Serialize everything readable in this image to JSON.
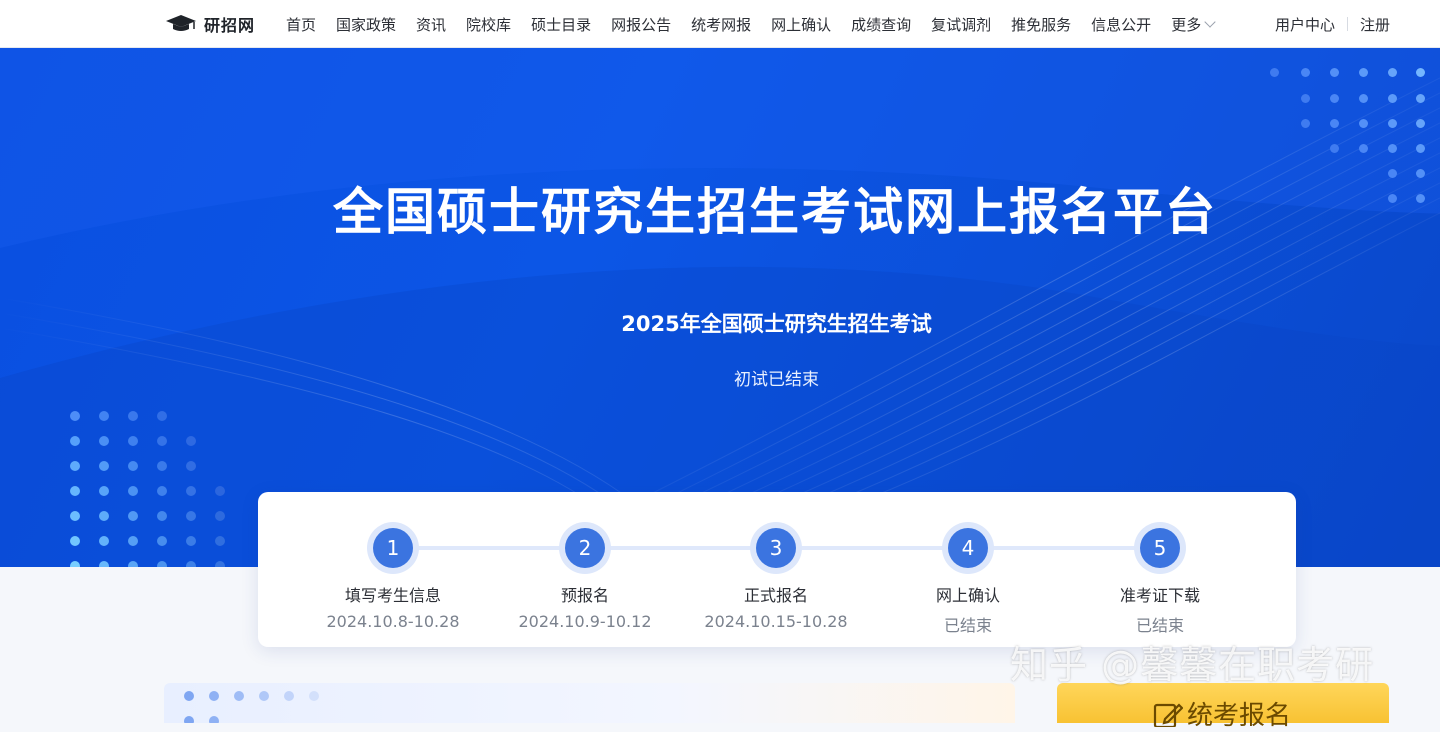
{
  "header": {
    "brand": "研招网",
    "nav": [
      "首页",
      "国家政策",
      "资讯",
      "院校库",
      "硕士目录",
      "网报公告",
      "统考网报",
      "网上确认",
      "成绩查询",
      "复试调剂",
      "推免服务",
      "信息公开"
    ],
    "more_label": "更多",
    "user_center": "用户中心",
    "register": "注册"
  },
  "hero": {
    "title": "全国硕士研究生招生考试网上报名平台",
    "subtitle": "2025年全国硕士研究生招生考试",
    "status": "初试已结束"
  },
  "steps": [
    {
      "num": "1",
      "name": "填写考生信息",
      "date": "2024.10.8-10.28"
    },
    {
      "num": "2",
      "name": "预报名",
      "date": "2024.10.9-10.12"
    },
    {
      "num": "3",
      "name": "正式报名",
      "date": "2024.10.15-10.28"
    },
    {
      "num": "4",
      "name": "网上确认",
      "date": "已结束"
    },
    {
      "num": "5",
      "name": "准考证下载",
      "date": "已结束"
    }
  ],
  "cta": {
    "label": "统考报名"
  },
  "watermark": "知乎 @馨馨在职考研",
  "colors": {
    "hero": "#0c56e6",
    "step_circle": "#3b74e0",
    "cta": "#f8c233"
  }
}
